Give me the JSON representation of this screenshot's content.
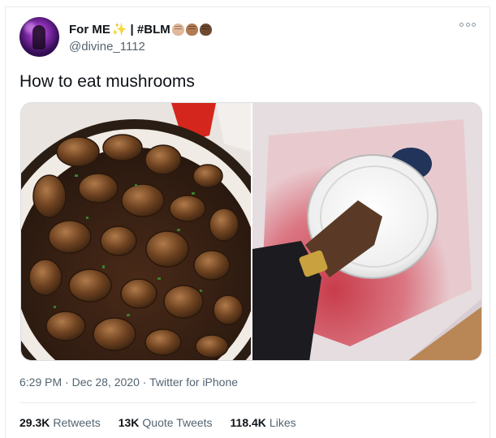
{
  "user": {
    "display_name": "For ME",
    "sparkle": "✨",
    "tag": "| #BLM",
    "handle": "@divine_1112"
  },
  "tweet": {
    "text": "How to eat mushrooms"
  },
  "meta": {
    "time": "6:29 PM",
    "dot1": "·",
    "date": "Dec 28, 2020",
    "dot2": "·",
    "source": "Twitter for iPhone"
  },
  "stats": {
    "retweets_count": "29.3K",
    "retweets_label": "Retweets",
    "quotes_count": "13K",
    "quotes_label": "Quote Tweets",
    "likes_count": "118.4K",
    "likes_label": "Likes"
  },
  "colors": {
    "text_primary": "#0f1419",
    "text_secondary": "#536471",
    "border": "#e6ecf0"
  },
  "icons": {
    "more": "more-options-icon",
    "fists": [
      "raised-fist-light-icon",
      "raised-fist-medium-icon",
      "raised-fist-dark-icon"
    ]
  }
}
